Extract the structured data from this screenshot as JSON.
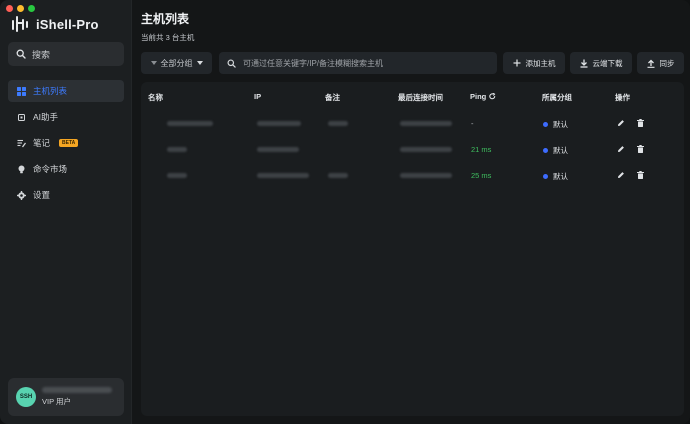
{
  "app": {
    "title": "iShell-Pro"
  },
  "sidebar": {
    "search_label": "搜索",
    "items": [
      {
        "label": "主机列表",
        "icon": "grid-icon",
        "active": true
      },
      {
        "label": "AI助手",
        "icon": "ai-chip-icon",
        "active": false
      },
      {
        "label": "笔记",
        "icon": "note-icon",
        "active": false,
        "badge": "BETA"
      },
      {
        "label": "命令市场",
        "icon": "bulb-icon",
        "active": false
      },
      {
        "label": "设置",
        "icon": "gear-icon",
        "active": false
      }
    ],
    "user": {
      "avatar_text": "SSH",
      "tier": "VIP 用户"
    }
  },
  "main": {
    "title": "主机列表",
    "subtitle": "当前共 3 台主机",
    "toolbar": {
      "group_filter": "全部分组",
      "search_placeholder": "可通过任意关键字/IP/备注模糊搜索主机",
      "add_host": "添加主机",
      "cloud_download": "云端下载",
      "sync": "同步"
    },
    "table": {
      "columns": {
        "name": "名称",
        "ip": "IP",
        "note": "备注",
        "last_connect": "最后连接时间",
        "ping": "Ping",
        "group": "所属分组",
        "actions": "操作"
      },
      "rows": [
        {
          "ping": "-",
          "group": "默认"
        },
        {
          "ping": "21 ms",
          "group": "默认"
        },
        {
          "ping": "25 ms",
          "group": "默认"
        }
      ]
    }
  },
  "colors": {
    "accent": "#3d7bff",
    "ping_ok": "#3fbf5f",
    "badge": "#f5a623",
    "avatar": "#58d3b0"
  }
}
